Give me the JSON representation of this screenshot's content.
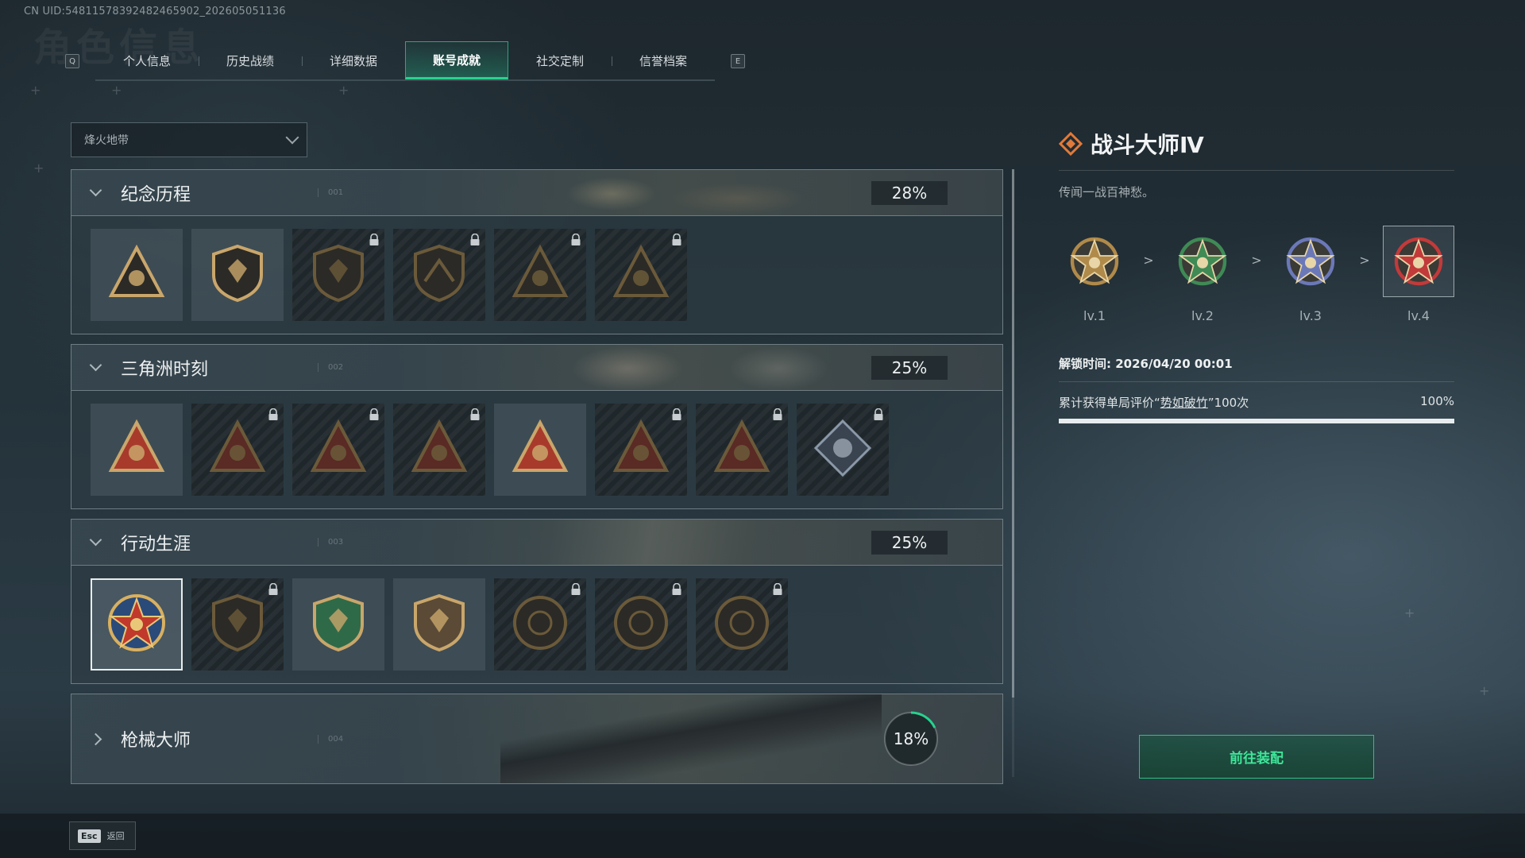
{
  "uid_text": "CN UID:5481157839248246590​2_202605051136",
  "background_watermark": "角色信息",
  "tabs": {
    "left_key": "Q",
    "right_key": "E",
    "items": [
      {
        "label": "个人信息"
      },
      {
        "label": "历史战绩"
      },
      {
        "label": "详细数据"
      },
      {
        "label": "账号成就",
        "active": true
      },
      {
        "label": "社交定制"
      },
      {
        "label": "信誉档案"
      }
    ]
  },
  "mode_dropdown": {
    "value": "烽火地带"
  },
  "sections": [
    {
      "title": "纪念历程",
      "num": "001",
      "percent": "28%",
      "expanded": true,
      "badges": [
        {
          "icon": "triangle-badge-icon",
          "locked": false
        },
        {
          "icon": "helicopter-shield-icon",
          "locked": false
        },
        {
          "icon": "shield-emblem-icon",
          "locked": true
        },
        {
          "icon": "tower-emblem-icon",
          "locked": true
        },
        {
          "icon": "hooded-triangle-icon",
          "locked": true
        },
        {
          "icon": "skull-triangle-icon",
          "locked": true
        }
      ]
    },
    {
      "title": "三角洲时刻",
      "num": "002",
      "percent": "25%",
      "expanded": true,
      "badges": [
        {
          "icon": "red-triangle-figure-icon",
          "locked": false
        },
        {
          "icon": "red-triangle-helmet-icon",
          "locked": true
        },
        {
          "icon": "red-triangle-soldier-icon",
          "locked": true
        },
        {
          "icon": "red-triangle-grenade-icon",
          "locked": true
        },
        {
          "icon": "red-triangle-squad-icon",
          "locked": false
        },
        {
          "icon": "red-triangle-beast-icon",
          "locked": true
        },
        {
          "icon": "red-triangle-eagle-icon",
          "locked": true
        },
        {
          "icon": "diamond-rose-icon",
          "locked": true
        }
      ]
    },
    {
      "title": "行动生涯",
      "num": "003",
      "percent": "25%",
      "expanded": true,
      "badges": [
        {
          "icon": "star-medal-icon",
          "locked": false,
          "selected": true
        },
        {
          "icon": "dark-shield-icon",
          "locked": true
        },
        {
          "icon": "green-shield-icon",
          "locked": false
        },
        {
          "icon": "gem-shield-icon",
          "locked": false
        },
        {
          "icon": "round-helmet-icon",
          "locked": true
        },
        {
          "icon": "round-crosshair-icon",
          "locked": true
        },
        {
          "icon": "round-eye-icon",
          "locked": true
        }
      ]
    },
    {
      "title": "枪械大师",
      "num": "004",
      "percent": "18%",
      "expanded": false,
      "ring_fraction": 0.18
    }
  ],
  "detail": {
    "title": "战斗大师Ⅳ",
    "description": "传闻一战百神愁。",
    "levels": [
      {
        "label": "lv.1",
        "color": "#b08a4a"
      },
      {
        "label": "lv.2",
        "color": "#3f8a55"
      },
      {
        "label": "lv.3",
        "color": "#6b78b8"
      },
      {
        "label": "lv.4",
        "color": "#c23a3a",
        "selected": true
      }
    ],
    "level_separator": ">",
    "unlock_time": "解锁时间: 2026/04/20 00:01",
    "condition_prefix": "累计获得单局评价“",
    "condition_link": "势如破竹",
    "condition_suffix": "”100次",
    "condition_percent": "100%",
    "progress_fraction": 1.0,
    "equip_button": "前往装配"
  },
  "footer": {
    "esc_key": "Esc",
    "back_label": "返回"
  },
  "colors": {
    "accent_green": "#27d28e",
    "button_text": "#3fe69a"
  }
}
